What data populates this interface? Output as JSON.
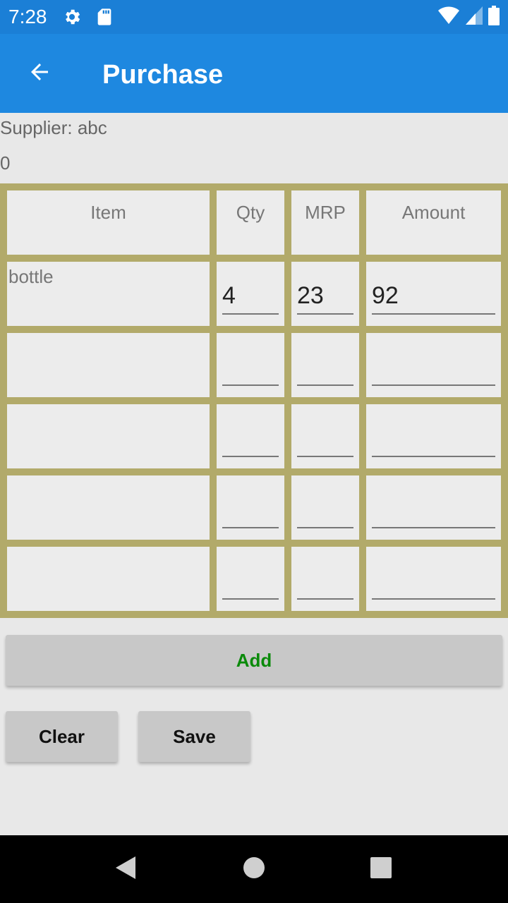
{
  "status_bar": {
    "time": "7:28",
    "left_icons": [
      "gear-icon",
      "sd-card-icon"
    ],
    "right_icons": [
      "wifi-icon",
      "signal-icon",
      "battery-icon"
    ]
  },
  "app_bar": {
    "title": "Purchase",
    "back_icon": "arrow-back-icon",
    "color": "#1e88e0"
  },
  "supplier_label": "Supplier: abc",
  "total_value": "0",
  "table": {
    "headers": [
      "Item",
      "Qty",
      "MRP",
      "Amount"
    ],
    "rows": [
      {
        "item": "bottle",
        "qty": "4",
        "mrp": "23",
        "amount": "92"
      },
      {
        "item": "",
        "qty": "",
        "mrp": "",
        "amount": ""
      },
      {
        "item": "",
        "qty": "",
        "mrp": "",
        "amount": ""
      },
      {
        "item": "",
        "qty": "",
        "mrp": "",
        "amount": ""
      },
      {
        "item": "",
        "qty": "",
        "mrp": "",
        "amount": ""
      }
    ],
    "border_color": "#b2aa6a"
  },
  "buttons": {
    "add": "Add",
    "clear": "Clear",
    "save": "Save",
    "add_color": "#0a8a0a"
  },
  "nav_bar": {
    "icons": [
      "back-triangle-icon",
      "home-circle-icon",
      "recents-square-icon"
    ]
  }
}
